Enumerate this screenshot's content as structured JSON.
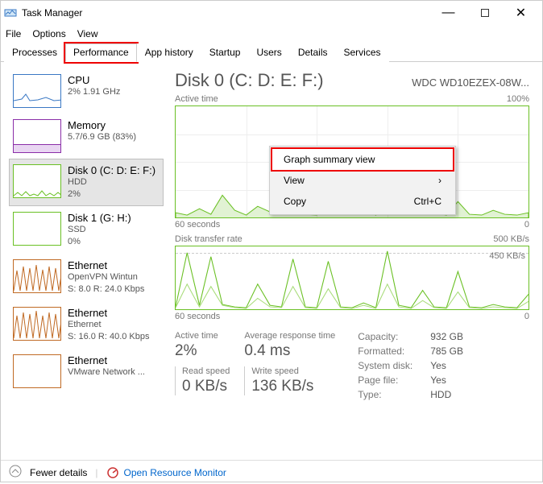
{
  "window": {
    "title": "Task Manager"
  },
  "wincontrols": {
    "min": "—",
    "max": "□",
    "close": "✕"
  },
  "menubar": [
    "File",
    "Options",
    "View"
  ],
  "tabs": [
    "Processes",
    "Performance",
    "App history",
    "Startup",
    "Users",
    "Details",
    "Services"
  ],
  "active_tab": 1,
  "sidebar": {
    "items": [
      {
        "title": "CPU",
        "line2": "2% 1.91 GHz",
        "line3": "",
        "color": "#3a78c4"
      },
      {
        "title": "Memory",
        "line2": "5.7/6.9 GB (83%)",
        "line3": "",
        "color": "#8a2ea8"
      },
      {
        "title": "Disk 0 (C: D: E: F:)",
        "line2": "HDD",
        "line3": "2%",
        "color": "#6ac024",
        "selected": true
      },
      {
        "title": "Disk 1 (G: H:)",
        "line2": "SSD",
        "line3": "0%",
        "color": "#6ac024"
      },
      {
        "title": "Ethernet",
        "line2": "OpenVPN Wintun",
        "line3": "S: 8.0 R: 24.0 Kbps",
        "color": "#c06a24"
      },
      {
        "title": "Ethernet",
        "line2": "Ethernet",
        "line3": "S: 16.0 R: 40.0 Kbps",
        "color": "#c06a24"
      },
      {
        "title": "Ethernet",
        "line2": "VMware Network ...",
        "line3": "",
        "color": "#c06a24"
      }
    ]
  },
  "main": {
    "title": "Disk 0 (C: D: E: F:)",
    "subtitle": "WDC WD10EZEX-08W...",
    "chart1": {
      "label_top_left": "Active time",
      "label_top_right": "100%",
      "label_bot_left": "60 seconds",
      "label_bot_right": "0"
    },
    "chart2": {
      "label_top_left": "Disk transfer rate",
      "label_top_right": "500 KB/s",
      "inner_right": "450 KB/s",
      "label_bot_left": "60 seconds",
      "label_bot_right": "0"
    },
    "stats": {
      "active_time_lbl": "Active time",
      "active_time_val": "2%",
      "avg_resp_lbl": "Average response time",
      "avg_resp_val": "0.4 ms",
      "read_lbl": "Read speed",
      "read_val": "0 KB/s",
      "write_lbl": "Write speed",
      "write_val": "136 KB/s"
    },
    "props": {
      "capacity_k": "Capacity:",
      "capacity_v": "932 GB",
      "formatted_k": "Formatted:",
      "formatted_v": "785 GB",
      "system_k": "System disk:",
      "system_v": "Yes",
      "pagefile_k": "Page file:",
      "pagefile_v": "Yes",
      "type_k": "Type:",
      "type_v": "HDD"
    }
  },
  "context_menu": {
    "item1": "Graph summary view",
    "item2": "View",
    "item3": "Copy",
    "item3_accel": "Ctrl+C"
  },
  "footer": {
    "fewer": "Fewer details",
    "orm": "Open Resource Monitor"
  },
  "chart_data": [
    {
      "type": "area",
      "title": "Active time",
      "xlabel": "60 seconds → 0",
      "ylabel": "Active time %",
      "ylim": [
        0,
        100
      ],
      "x_seconds_ago": [
        60,
        58,
        56,
        54,
        52,
        50,
        48,
        46,
        44,
        42,
        40,
        38,
        36,
        34,
        32,
        30,
        28,
        26,
        24,
        22,
        20,
        18,
        16,
        14,
        12,
        10,
        8,
        6,
        4,
        2,
        0
      ],
      "values_pct": [
        4,
        2,
        8,
        3,
        20,
        6,
        2,
        10,
        5,
        4,
        12,
        3,
        2,
        18,
        4,
        3,
        8,
        2,
        16,
        5,
        3,
        10,
        4,
        2,
        14,
        3,
        2,
        6,
        3,
        2,
        4
      ]
    },
    {
      "type": "line",
      "title": "Disk transfer rate",
      "xlabel": "60 seconds → 0",
      "ylabel": "KB/s",
      "ylim": [
        0,
        500
      ],
      "annotations": [
        "450 KB/s"
      ],
      "x_seconds_ago": [
        60,
        58,
        56,
        54,
        52,
        50,
        48,
        46,
        44,
        42,
        40,
        38,
        36,
        34,
        32,
        30,
        28,
        26,
        24,
        22,
        20,
        18,
        16,
        14,
        12,
        10,
        8,
        6,
        4,
        2,
        0
      ],
      "series": [
        {
          "name": "read",
          "values_kbps": [
            20,
            450,
            30,
            420,
            40,
            20,
            10,
            200,
            30,
            20,
            400,
            20,
            10,
            380,
            20,
            10,
            50,
            10,
            460,
            30,
            10,
            150,
            20,
            10,
            300,
            20,
            10,
            40,
            20,
            10,
            120
          ]
        },
        {
          "name": "write",
          "values_kbps": [
            10,
            200,
            20,
            180,
            30,
            10,
            5,
            90,
            20,
            10,
            180,
            10,
            5,
            160,
            10,
            5,
            30,
            5,
            200,
            20,
            5,
            70,
            10,
            5,
            140,
            10,
            5,
            20,
            10,
            5,
            60
          ]
        }
      ]
    }
  ]
}
